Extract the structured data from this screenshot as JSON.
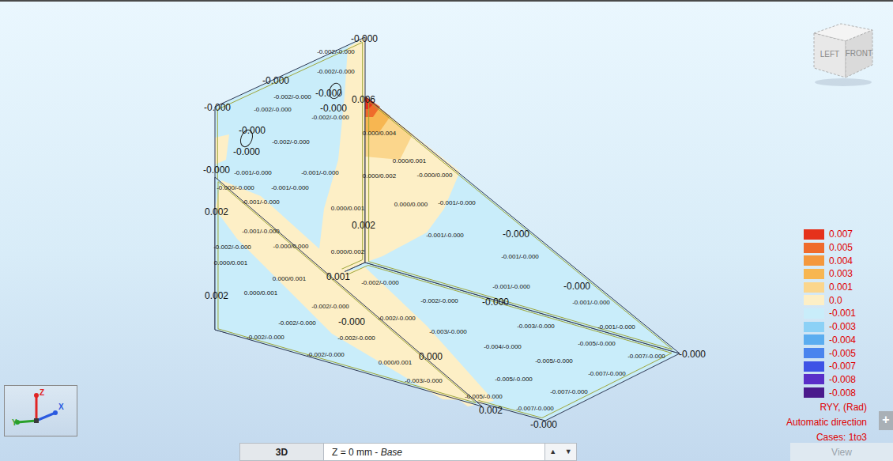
{
  "model_view": {
    "labels": [
      {
        "text": "-0.000",
        "kind": "value"
      },
      {
        "text": "-0.000",
        "kind": "value"
      },
      {
        "text": "-0.000",
        "kind": "value"
      },
      {
        "text": "-0.000",
        "kind": "value"
      },
      {
        "text": "-0.000",
        "kind": "value"
      },
      {
        "text": "0.006",
        "kind": "value"
      },
      {
        "text": "-0.000",
        "kind": "value"
      },
      {
        "text": "-0.000",
        "kind": "value"
      },
      {
        "text": "-0.000",
        "kind": "value"
      },
      {
        "text": "0.002",
        "kind": "value"
      },
      {
        "text": "0.002",
        "kind": "value"
      },
      {
        "text": "0.001",
        "kind": "value"
      },
      {
        "text": "0.002",
        "kind": "value"
      },
      {
        "text": "-0.000",
        "kind": "value"
      },
      {
        "text": "0.000",
        "kind": "value"
      },
      {
        "text": "0.002",
        "kind": "value"
      },
      {
        "text": "-0.000",
        "kind": "value"
      },
      {
        "text": "-0.000",
        "kind": "value"
      },
      {
        "text": "-0.000",
        "kind": "value"
      },
      {
        "text": "-0.000",
        "kind": "value"
      },
      {
        "text": "-0.000",
        "kind": "value"
      },
      {
        "text": "-0.002/-0.000",
        "kind": "range"
      },
      {
        "text": "-0.002/-0.000",
        "kind": "range"
      },
      {
        "text": "-0.002/-0.000",
        "kind": "range"
      },
      {
        "text": "-0.002/-0.000",
        "kind": "range"
      },
      {
        "text": "-0.002/-0.000",
        "kind": "range"
      },
      {
        "text": "-0.002/-0.000",
        "kind": "range"
      },
      {
        "text": "0.000/0.004",
        "kind": "range"
      },
      {
        "text": "0.000/0.001",
        "kind": "range"
      },
      {
        "text": "-0.000/0.000",
        "kind": "range"
      },
      {
        "text": "0.000/0.002",
        "kind": "range"
      },
      {
        "text": "-0.001/-0.000",
        "kind": "range"
      },
      {
        "text": "-0.001/-0.000",
        "kind": "range"
      },
      {
        "text": "-0.000/-0.000",
        "kind": "range"
      },
      {
        "text": "-0.001/-0.000",
        "kind": "range"
      },
      {
        "text": "-0.001/-0.000",
        "kind": "range"
      },
      {
        "text": "0.000/0.001",
        "kind": "range"
      },
      {
        "text": "0.000/0.000",
        "kind": "range"
      },
      {
        "text": "-0.001/-0.000",
        "kind": "range"
      },
      {
        "text": "-0.001/-0.000",
        "kind": "range"
      },
      {
        "text": "-0.001/-0.000",
        "kind": "range"
      },
      {
        "text": "-0.002/-0.000",
        "kind": "range"
      },
      {
        "text": "-0.000/0.000",
        "kind": "range"
      },
      {
        "text": "0.000/0.002",
        "kind": "range"
      },
      {
        "text": "-0.001/-0.000",
        "kind": "range"
      },
      {
        "text": "0.000/0.001",
        "kind": "range"
      },
      {
        "text": "0.000/0.001",
        "kind": "range"
      },
      {
        "text": "-0.002/-0.000",
        "kind": "range"
      },
      {
        "text": "-0.001/-0.000",
        "kind": "range"
      },
      {
        "text": "0.000/0.001",
        "kind": "range"
      },
      {
        "text": "-0.001/-0.000",
        "kind": "range"
      },
      {
        "text": "-0.002/-0.000",
        "kind": "range"
      },
      {
        "text": "-0.002/-0.000",
        "kind": "range"
      },
      {
        "text": "-0.002/-0.000",
        "kind": "range"
      },
      {
        "text": "-0.002/-0.000",
        "kind": "range"
      },
      {
        "text": "-0.003/-0.000",
        "kind": "range"
      },
      {
        "text": "-0.001/-0.000",
        "kind": "range"
      },
      {
        "text": "-0.003/-0.000",
        "kind": "range"
      },
      {
        "text": "-0.002/-0.000",
        "kind": "range"
      },
      {
        "text": "-0.002/-0.000",
        "kind": "range"
      },
      {
        "text": "-0.004/-0.000",
        "kind": "range"
      },
      {
        "text": "-0.005/-0.000",
        "kind": "range"
      },
      {
        "text": "-0.002/-0.000",
        "kind": "range"
      },
      {
        "text": "-0.007/-0.000",
        "kind": "range"
      },
      {
        "text": "0.000/0.001",
        "kind": "range"
      },
      {
        "text": "-0.005/-0.000",
        "kind": "range"
      },
      {
        "text": "-0.007/-0.000",
        "kind": "range"
      },
      {
        "text": "-0.005/-0.000",
        "kind": "range"
      },
      {
        "text": "-0.003/-0.000",
        "kind": "range"
      },
      {
        "text": "-0.007/-0.000",
        "kind": "range"
      },
      {
        "text": "-0.005/-0.000",
        "kind": "range"
      },
      {
        "text": "-0.007/-0.000",
        "kind": "range"
      }
    ]
  },
  "legend": {
    "entries": [
      {
        "value": "0.007",
        "color": "#e5321b"
      },
      {
        "value": "0.005",
        "color": "#ef6b2b"
      },
      {
        "value": "0.004",
        "color": "#f4983c"
      },
      {
        "value": "0.003",
        "color": "#f7b651"
      },
      {
        "value": "0.001",
        "color": "#fbd68c"
      },
      {
        "value": "0.0",
        "color": "#fdefc6"
      },
      {
        "value": "-0.001",
        "color": "#c9edfa"
      },
      {
        "value": "-0.003",
        "color": "#8cd1f6"
      },
      {
        "value": "-0.004",
        "color": "#5badf0"
      },
      {
        "value": "-0.005",
        "color": "#4a84ee"
      },
      {
        "value": "-0.007",
        "color": "#3d52e6"
      },
      {
        "value": "-0.008",
        "color": "#5a2ec8"
      },
      {
        "value": "-0.008",
        "color": "#4a1a8c"
      }
    ],
    "title": "RYY, (Rad)",
    "direction": "Automatic direction",
    "cases": "Cases: 1to3"
  },
  "view_cube": {
    "faces": [
      "LEFT",
      "FRONT"
    ]
  },
  "axes": [
    {
      "label": "Z",
      "color": "#e02424"
    },
    {
      "label": "Y",
      "color": "#2aa02a"
    },
    {
      "label": "X",
      "color": "#2a5ae0"
    }
  ],
  "bottom_bar": {
    "view_mode": "3D",
    "plane": "Z = 0 mm - ",
    "plane_name": "Base",
    "arrows": [
      "▲",
      "▼"
    ],
    "view_button": "View"
  },
  "expand_button": "+"
}
